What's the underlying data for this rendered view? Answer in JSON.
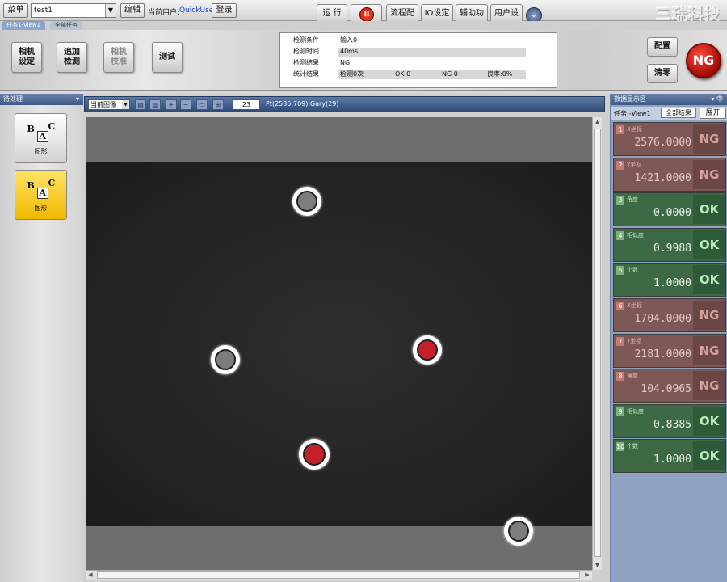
{
  "topbar": {
    "menu_label": "菜单",
    "project_name": "test1",
    "edit_label": "编辑",
    "current_user_label": "当前用户:",
    "current_user_value": "QuickUser",
    "login_label": "登录",
    "run_label": "运 行",
    "pause_glyph": "II",
    "buttons": [
      "流程配置",
      "IO设定",
      "辅助功能",
      "用户设定"
    ],
    "expand_glyph": "⌄",
    "brand": "三瑞科技"
  },
  "task_tabs": [
    "任务1-View1",
    "全部任务"
  ],
  "toolbar": {
    "camera_settings": [
      "相机",
      "设定"
    ],
    "add_detection": [
      "追加",
      "检测"
    ],
    "camera_calibration": [
      "相机",
      "校准"
    ],
    "test_label": "测试",
    "config_label": "配置",
    "clear_label": "清零",
    "overall_result": "NG"
  },
  "status": {
    "condition_label": "检测条件",
    "condition_value": "输入0",
    "time_label": "检测时间",
    "time_value": "40ms",
    "result_label": "检测结果",
    "result_value": "NG",
    "stats_label": "统计结果",
    "stats_total": "检测0次",
    "stats_ok": "OK 0",
    "stats_ng": "NG 0",
    "stats_rate": "良率:0%"
  },
  "left_panel": {
    "title": "待处理",
    "pin": "▾",
    "tools": [
      {
        "letters": [
          "B",
          "A",
          "C"
        ],
        "label": "图形"
      },
      {
        "letters": [
          "B",
          "A",
          "C"
        ],
        "label": "图形"
      }
    ]
  },
  "image_panel": {
    "select_value": "当前图像",
    "zoom_value": "23",
    "pixel_info": "Pt(2535,709),Gary(29)"
  },
  "right_panel": {
    "title": "数据显示区",
    "pin": "▾ 中",
    "task_label": "任务:-View1",
    "all_results_label": "全部结果",
    "expand_label": "展开",
    "items": [
      {
        "num": "1",
        "label": "X坐标",
        "value": "2576.0000",
        "result": "NG",
        "status": "ng"
      },
      {
        "num": "2",
        "label": "Y坐标",
        "value": "1421.0000",
        "result": "NG",
        "status": "ng"
      },
      {
        "num": "3",
        "label": "角度",
        "value": "0.0000",
        "result": "OK",
        "status": "ok"
      },
      {
        "num": "4",
        "label": "相似度",
        "value": "0.9988",
        "result": "OK",
        "status": "ok"
      },
      {
        "num": "5",
        "label": "个数",
        "value": "1.0000",
        "result": "OK",
        "status": "ok"
      },
      {
        "num": "6",
        "label": "X坐标",
        "value": "1704.0000",
        "result": "NG",
        "status": "ng"
      },
      {
        "num": "7",
        "label": "Y坐标",
        "value": "2181.0000",
        "result": "NG",
        "status": "ng"
      },
      {
        "num": "8",
        "label": "角度",
        "value": "104.0965",
        "result": "NG",
        "status": "ng"
      },
      {
        "num": "9",
        "label": "相似度",
        "value": "0.8385",
        "result": "OK",
        "status": "ok"
      },
      {
        "num": "10",
        "label": "个数",
        "value": "1.0000",
        "result": "OK",
        "status": "ok"
      }
    ]
  },
  "colors": {
    "ng_item": "#7d5856",
    "ok_item": "#3d6a45",
    "accent_blue": "#3f5a86",
    "ng_red": "#c41808"
  }
}
